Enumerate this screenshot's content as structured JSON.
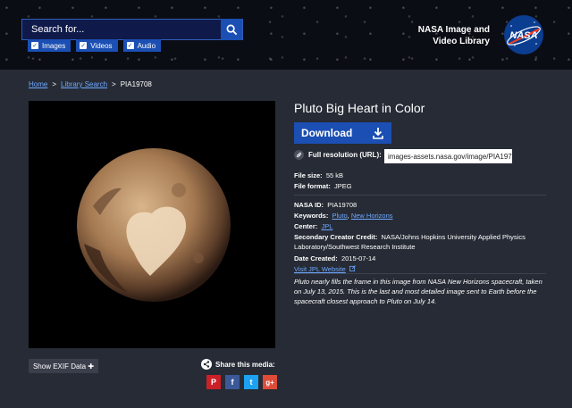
{
  "header": {
    "search_placeholder": "Search for...",
    "filters": [
      {
        "label": "Images",
        "checked": true
      },
      {
        "label": "Videos",
        "checked": true
      },
      {
        "label": "Audio",
        "checked": true
      }
    ],
    "brand_line1": "NASA Image and",
    "brand_line2": "Video Library",
    "logo_text": "NASA"
  },
  "breadcrumb": {
    "home": "Home",
    "sep1": ">",
    "library_search": "Library Search",
    "sep2": ">",
    "current": "PIA19708"
  },
  "media": {
    "exif_button": "Show EXIF Data ✚",
    "share_label": "Share this media:",
    "social": [
      {
        "icon": "pinterest-icon",
        "glyph": "P",
        "color": "#cb2027"
      },
      {
        "icon": "facebook-icon",
        "glyph": "f",
        "color": "#3b5998"
      },
      {
        "icon": "twitter-icon",
        "glyph": "t",
        "color": "#1da1f2"
      },
      {
        "icon": "google-plus-icon",
        "glyph": "g+",
        "color": "#dd4b39"
      }
    ]
  },
  "details": {
    "title": "Pluto Big Heart in Color",
    "download_label": "Download",
    "fullres_label": "Full resolution (URL):",
    "fullres_value": "images-assets.nasa.gov/image/PIA197",
    "file_size_label": "File size:",
    "file_size_value": "55 kB",
    "file_format_label": "File format:",
    "file_format_value": "JPEG",
    "nasa_id_label": "NASA ID:",
    "nasa_id_value": "PIA19708",
    "keywords_label": "Keywords:",
    "keyword1": "Pluto",
    "keyword_sep": ",",
    "keyword2": "New Horizons",
    "center_label": "Center:",
    "center_value": "JPL",
    "creator_label": "Secondary Creator Credit:",
    "creator_value_line1": "NASA/Johns Hopkins University Applied Physics",
    "creator_value_line2": "Laboratory/Southwest Research Institute",
    "date_label": "Date Created:",
    "date_value": "2015-07-14",
    "visit_link": "Visit JPL Website",
    "description": "Pluto nearly fills the frame in this image from NASA New Horizons spacecraft, taken on July 13, 2015. This is the last and most detailed image sent to Earth before the spacecraft closest approach to Pluto on July 14."
  },
  "colors": {
    "accent": "#1b4fb3",
    "link": "#6fa8ff",
    "background": "#262b35"
  }
}
